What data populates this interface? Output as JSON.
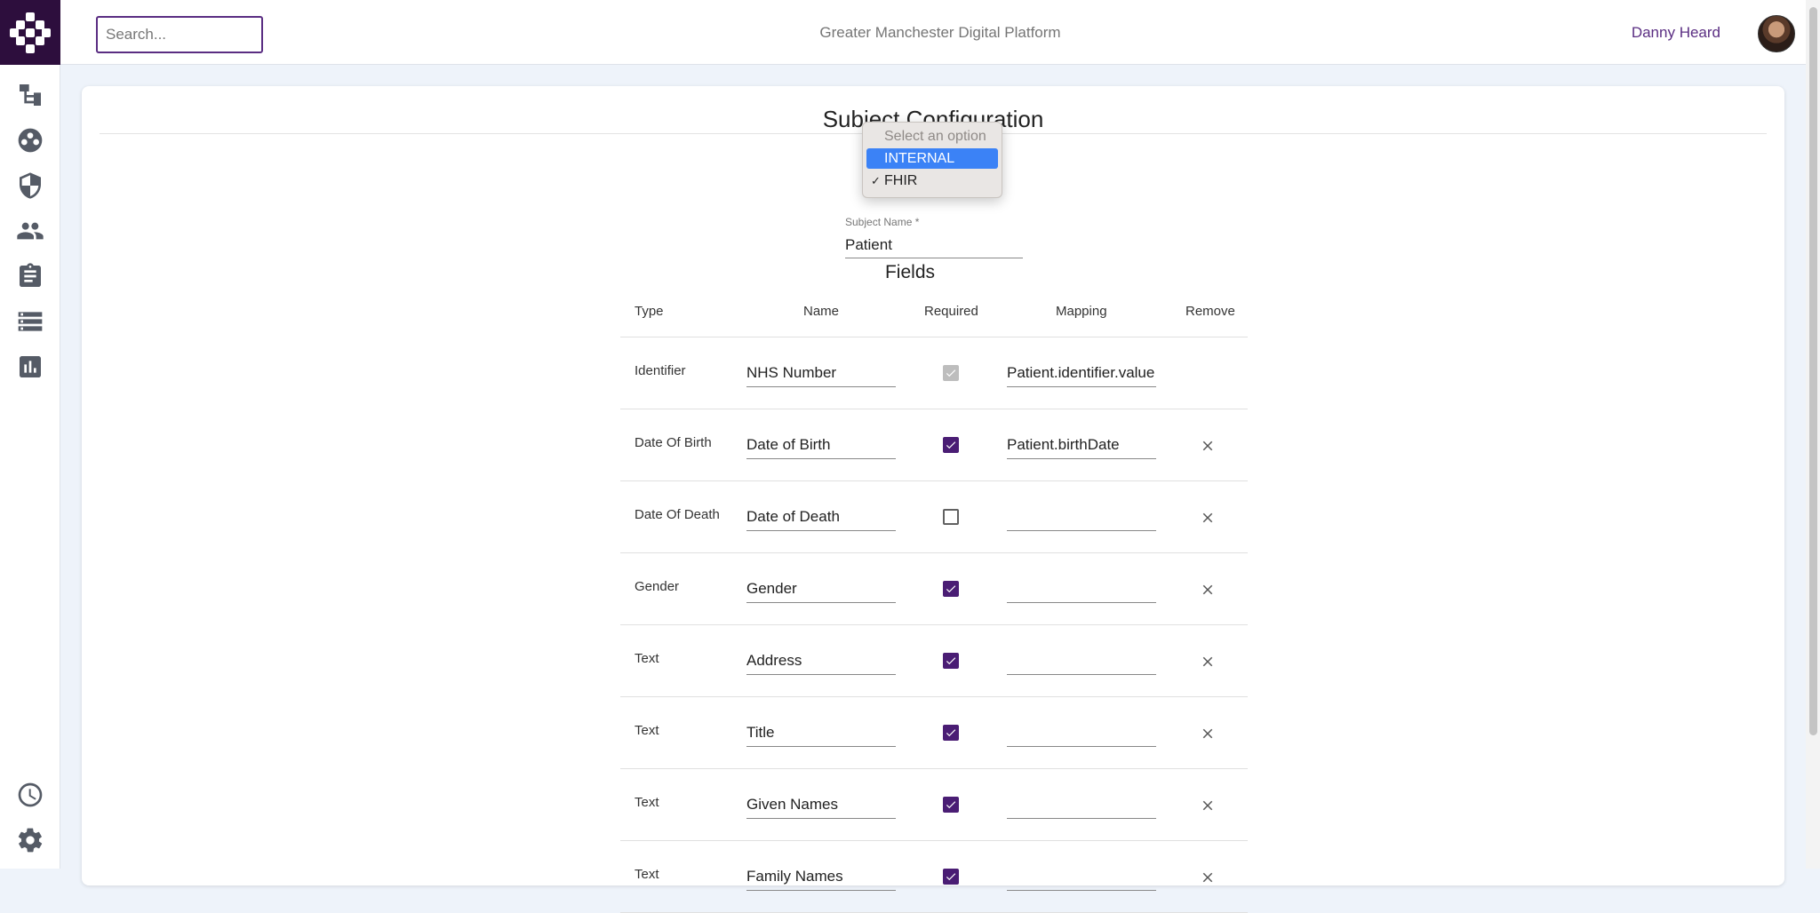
{
  "topbar": {
    "search_placeholder": "Search...",
    "platform_title": "Greater Manchester Digital Platform",
    "user_name": "Danny Heard"
  },
  "sidebar": {
    "items": [
      {
        "icon": "hierarchy-icon"
      },
      {
        "icon": "cohort-icon"
      },
      {
        "icon": "shield-icon"
      },
      {
        "icon": "people-icon"
      },
      {
        "icon": "clipboard-icon"
      },
      {
        "icon": "list-icon"
      },
      {
        "icon": "chart-icon"
      }
    ],
    "bottom_items": [
      {
        "icon": "clock-icon"
      },
      {
        "icon": "gear-icon"
      }
    ]
  },
  "page": {
    "title": "Subject Configuration",
    "dropdown": {
      "placeholder": "Select an option",
      "options": [
        "INTERNAL",
        "FHIR"
      ],
      "highlighted": "INTERNAL",
      "checked": "FHIR",
      "check_mark": "✓"
    },
    "subject_name_label": "Subject Name *",
    "subject_name_value": "Patient",
    "fields_title": "Fields"
  },
  "table": {
    "headers": {
      "type": "Type",
      "name": "Name",
      "required": "Required",
      "mapping": "Mapping",
      "remove": "Remove"
    },
    "rows": [
      {
        "type": "Identifier",
        "name": "NHS Number",
        "required": "disabled",
        "mapping": "Patient.identifier.value",
        "removable": false
      },
      {
        "type": "Date Of Birth",
        "name": "Date of Birth",
        "required": "on",
        "mapping": "Patient.birthDate",
        "removable": true
      },
      {
        "type": "Date Of Death",
        "name": "Date of Death",
        "required": "off",
        "mapping": "",
        "removable": true
      },
      {
        "type": "Gender",
        "name": "Gender",
        "required": "on",
        "mapping": "",
        "removable": true
      },
      {
        "type": "Text",
        "name": "Address",
        "required": "on",
        "mapping": "",
        "removable": true
      },
      {
        "type": "Text",
        "name": "Title",
        "required": "on",
        "mapping": "",
        "removable": true
      },
      {
        "type": "Text",
        "name": "Given Names",
        "required": "on",
        "mapping": "",
        "removable": true
      },
      {
        "type": "Text",
        "name": "Family Names",
        "required": "on",
        "mapping": "",
        "removable": true
      }
    ]
  },
  "colors": {
    "brand": "#2d0e3d",
    "accent": "#4a1d74",
    "user_text": "#5a2d82",
    "dropdown_highlight": "#3b82f6"
  }
}
